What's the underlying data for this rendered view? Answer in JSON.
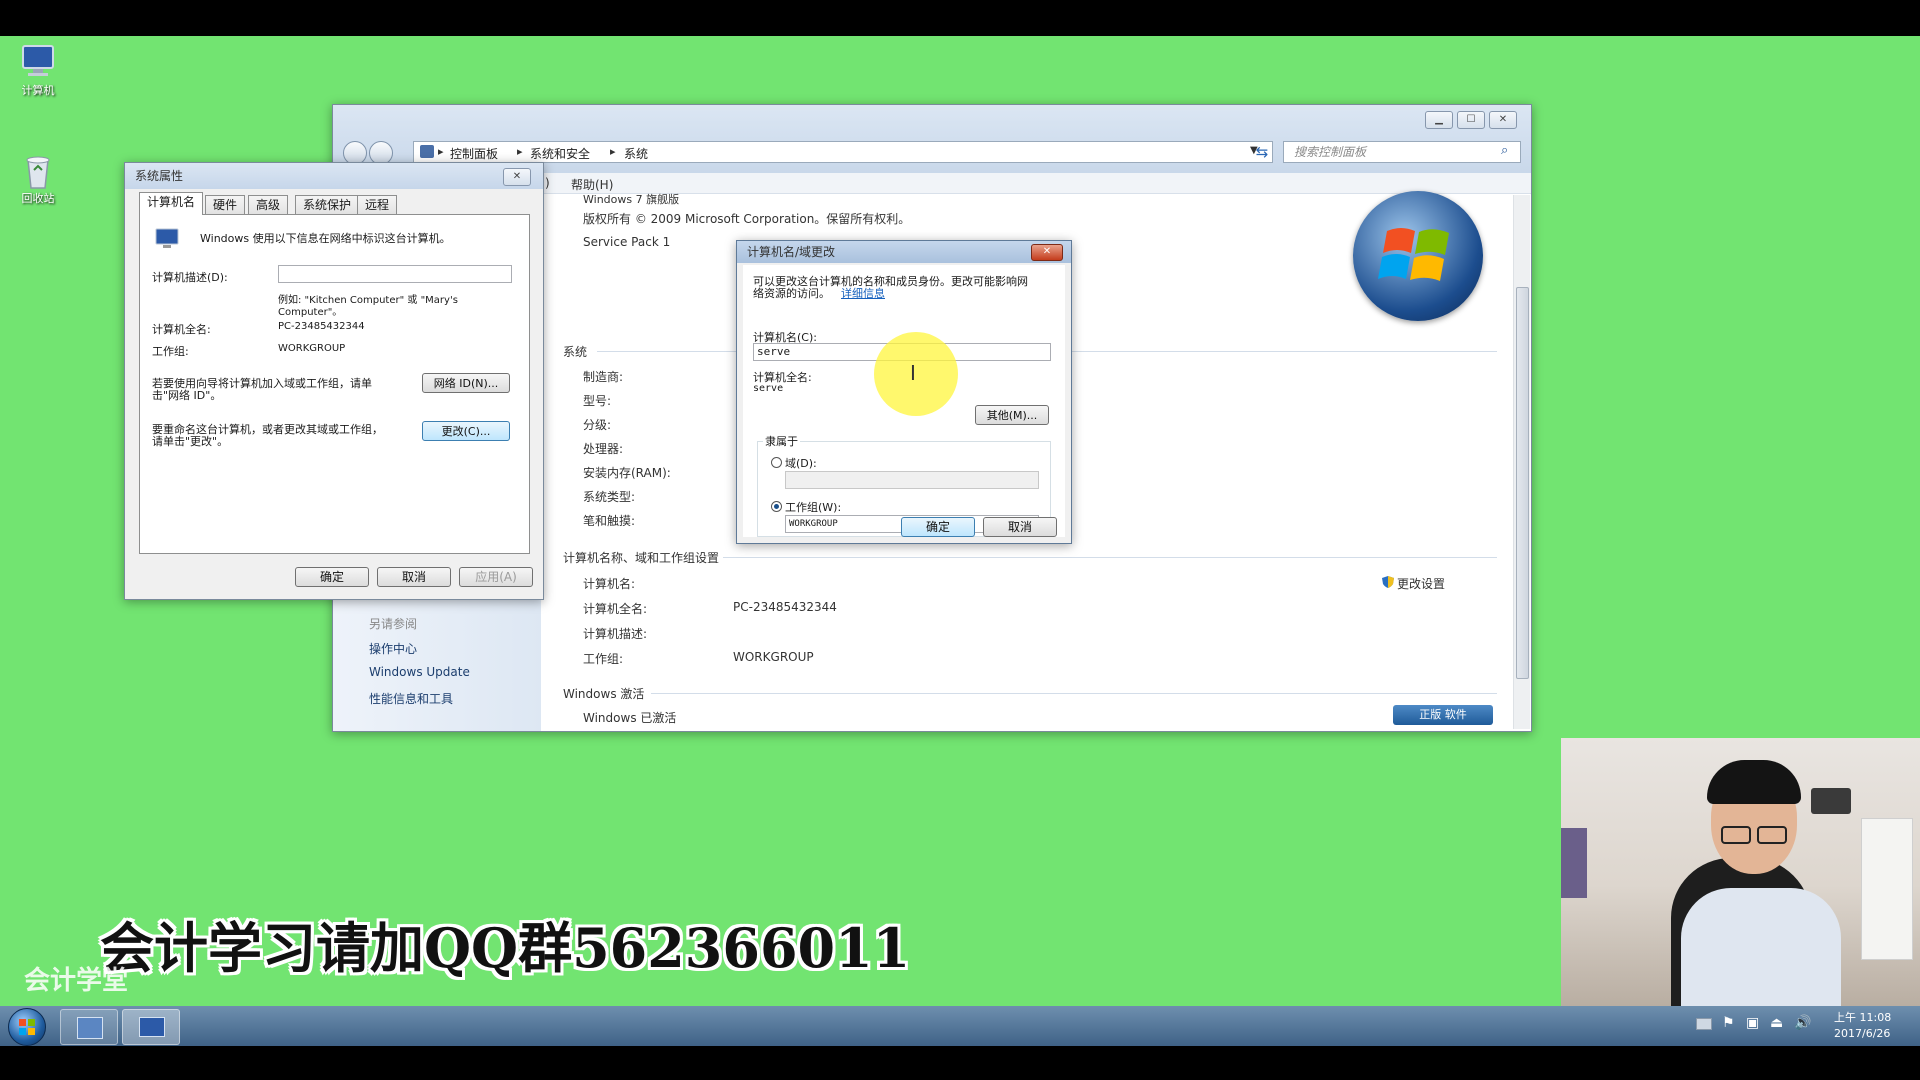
{
  "desktop": {
    "icons": [
      {
        "label": "计算机",
        "icon": "computer-icon"
      },
      {
        "label": "回收站",
        "icon": "recycle-bin-icon"
      }
    ],
    "watermark": "会计学习请加QQ群562366011",
    "logo": "会计学堂"
  },
  "control_panel": {
    "breadcrumb": [
      "控制面板",
      "系统和安全",
      "系统"
    ],
    "search_placeholder": "搜索控制面板",
    "menu_help": "帮助(H)",
    "menu_partial": ")",
    "edition_partial": "Windows 7 旗舰版",
    "copyright": "版权所有 © 2009 Microsoft Corporation。保留所有权利。",
    "service_pack": "Service Pack 1",
    "system_section": "系统",
    "system_labels": [
      "制造商:",
      "型号:",
      "分级:",
      "处理器:",
      "安装内存(RAM):",
      "系统类型:",
      "笔和触摸:"
    ],
    "name_section": "计算机名称、域和工作组设置",
    "name_labels": [
      "计算机名:",
      "计算机全名:",
      "计算机描述:",
      "工作组:"
    ],
    "full_name_partial": "PC-23485432344",
    "workgroup_value": "WORKGROUP",
    "change_settings": "更改设置",
    "see_also": "另请参阅",
    "links": [
      "操作中心",
      "Windows Update",
      "性能信息和工具"
    ],
    "activation_section": "Windows 激活",
    "activation_status": "Windows 已激活",
    "genuine_button": "正版 软件"
  },
  "sys_props": {
    "title": "系统属性",
    "tabs": [
      "计算机名",
      "硬件",
      "高级",
      "系统保护",
      "远程"
    ],
    "intro": "Windows 使用以下信息在网络中标识这台计算机。",
    "desc_label": "计算机描述(D):",
    "desc_value": "",
    "example_line1": "例如: \"Kitchen Computer\" 或 \"Mary's",
    "example_line2": "Computer\"。",
    "fullname_label": "计算机全名:",
    "fullname_value": "PC-23485432344",
    "workgroup_label": "工作组:",
    "workgroup_value": "WORKGROUP",
    "network_text_1": "若要使用向导将计算机加入域或工作组，请单",
    "network_text_2": "击\"网络 ID\"。",
    "network_button": "网络 ID(N)...",
    "rename_text_1": "要重命名这台计算机，或者更改其域或工作组，",
    "rename_text_2": "请单击\"更改\"。",
    "change_button": "更改(C)...",
    "ok": "确定",
    "cancel": "取消",
    "apply": "应用(A)"
  },
  "rename_dialog": {
    "title": "计算机名/域更改",
    "desc_line1": "可以更改这台计算机的名称和成员身份。更改可能影响网",
    "desc_line2": "络资源的访问。",
    "details_link": "详细信息",
    "name_label": "计算机名(C):",
    "name_value": "serve",
    "fullname_label": "计算机全名:",
    "fullname_value": "serve",
    "other_button": "其他(M)...",
    "member_of": "隶属于",
    "domain_label": "域(D):",
    "domain_value": "",
    "workgroup_label": "工作组(W):",
    "workgroup_value": "WORKGROUP",
    "ok": "确定",
    "cancel": "取消"
  },
  "taskbar": {
    "time": "上午 11:08",
    "date": "2017/6/26"
  }
}
